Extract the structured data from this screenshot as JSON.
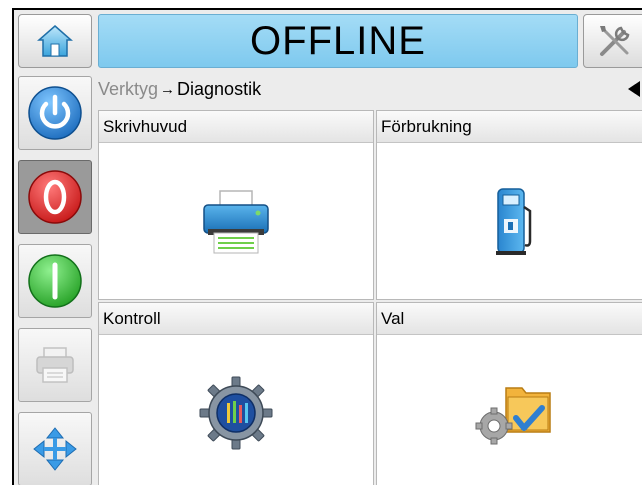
{
  "header": {
    "status": "OFFLINE",
    "home_icon": "home-icon",
    "tools_icon": "tools-icon"
  },
  "sidebar": {
    "buttons": [
      {
        "name": "power-icon",
        "color": "#1a7fd6"
      },
      {
        "name": "stop-icon",
        "color": "#e01f1f"
      },
      {
        "name": "start-icon",
        "color": "#2dbb2d"
      },
      {
        "name": "printer-icon",
        "color": "#c9c9c9"
      },
      {
        "name": "navigation-arrows-icon",
        "color": "#2a8fe0"
      }
    ]
  },
  "breadcrumb": {
    "parent": "Verktyg",
    "separator": "→",
    "current": "Diagnostik"
  },
  "tiles": [
    {
      "label": "Skrivhuvud",
      "icon": "printhead-printer-icon"
    },
    {
      "label": "Förbrukning",
      "icon": "consumables-fuel-pump-icon"
    },
    {
      "label": "Kontroll",
      "icon": "control-gear-icon"
    },
    {
      "label": "Val",
      "icon": "options-folder-gear-icon"
    }
  ]
}
